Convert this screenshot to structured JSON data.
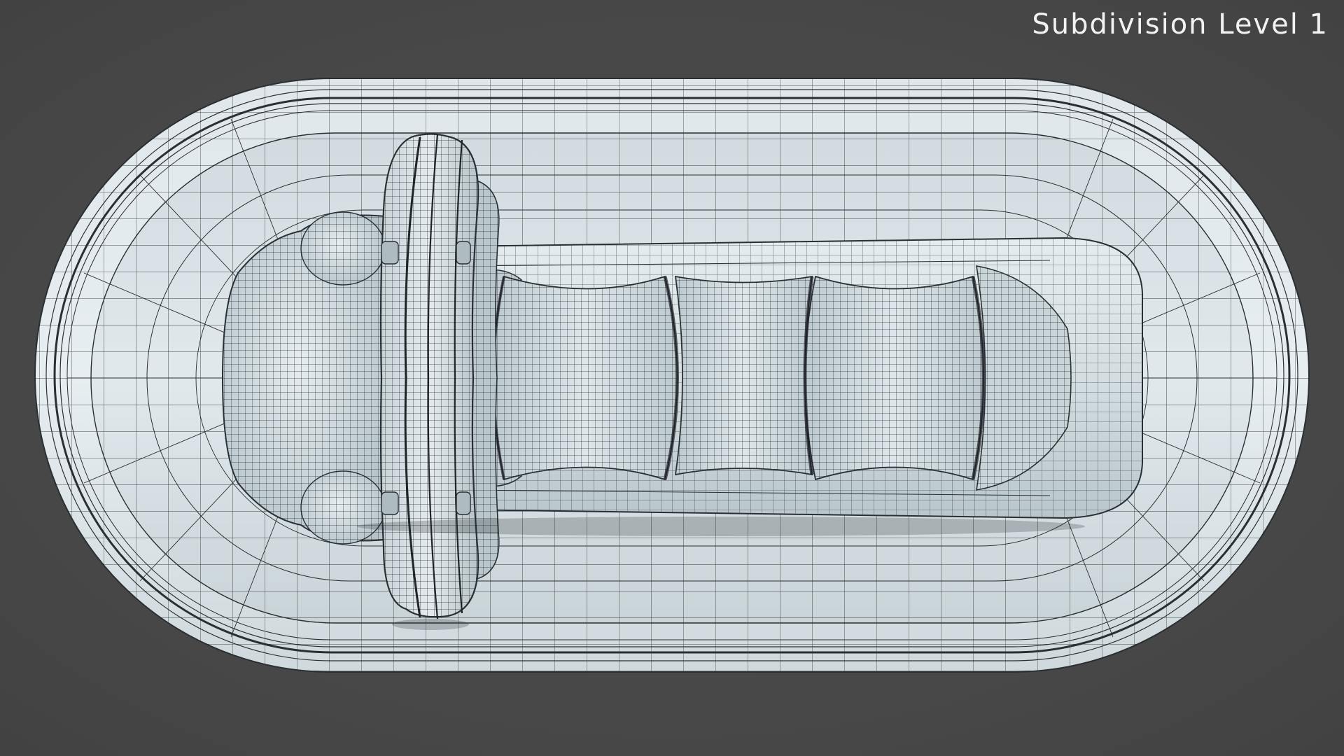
{
  "overlay": {
    "label": "Subdivision Level 1"
  },
  "scene": {
    "subject": "pacifier-in-tray-wireframe-render",
    "view": "top"
  },
  "colors": {
    "background": "#4a4a4a",
    "surface": "#d9e2e6",
    "surface_shadow": "#9fadb3",
    "wire": "#2a2f33",
    "label": "#f2f2f2"
  }
}
